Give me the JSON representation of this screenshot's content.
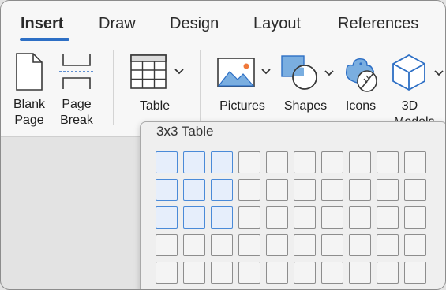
{
  "tabs": [
    {
      "label": "Insert",
      "active": true
    },
    {
      "label": "Draw",
      "active": false
    },
    {
      "label": "Design",
      "active": false
    },
    {
      "label": "Layout",
      "active": false
    },
    {
      "label": "References",
      "active": false
    }
  ],
  "buttons": {
    "blank_page": {
      "line1": "Blank",
      "line2": "Page",
      "icon": "blank-page-icon"
    },
    "page_break": {
      "line1": "Page",
      "line2": "Break",
      "icon": "page-break-icon"
    },
    "table": {
      "label": "Table",
      "icon": "table-icon"
    },
    "pictures": {
      "label": "Pictures",
      "icon": "picture-icon"
    },
    "shapes": {
      "label": "Shapes",
      "icon": "shapes-icon"
    },
    "icons": {
      "label": "Icons",
      "icon": "icons-icon"
    },
    "models_3d": {
      "line1": "3D",
      "line2": "Models",
      "icon": "cube-3d-icon"
    }
  },
  "table_picker": {
    "title": "3x3 Table",
    "selected_rows": 3,
    "selected_cols": 3,
    "visible_rows": 5,
    "visible_cols": 10
  },
  "colors": {
    "accent": "#2d6fc5",
    "selected_border": "#4a8ad8",
    "selected_fill": "#e6eefb",
    "picture_orange": "#f0783a"
  }
}
